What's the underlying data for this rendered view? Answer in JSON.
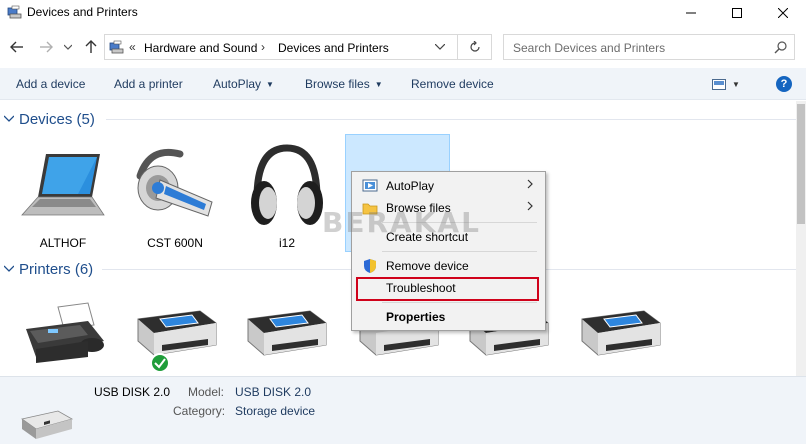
{
  "window": {
    "title": "Devices and Printers"
  },
  "address": {
    "overflow": "«",
    "crumbs": [
      "Hardware and Sound",
      "Devices and Printers"
    ],
    "separator": "›"
  },
  "search": {
    "placeholder": "Search Devices and Printers"
  },
  "commands": {
    "add_device": "Add a device",
    "add_printer": "Add a printer",
    "autoplay": "AutoPlay",
    "browse_files": "Browse files",
    "remove_device": "Remove device"
  },
  "groups": {
    "devices": {
      "title": "Devices (5)",
      "items": [
        "ALTHOF",
        "CST 600N",
        "i12"
      ]
    },
    "printers": {
      "title": "Printers (6)"
    }
  },
  "context_menu": {
    "items": [
      "AutoPlay",
      "Browse files",
      "Create shortcut",
      "Remove device",
      "Troubleshoot",
      "Properties"
    ]
  },
  "watermark": "BERAKAL",
  "details": {
    "name": "USB DISK 2.0",
    "model_label": "Model:",
    "model_value": "USB DISK 2.0",
    "category_label": "Category:",
    "category_value": "Storage device"
  },
  "colors": {
    "accent": "#1f4e8c",
    "highlight": "#d0021b",
    "selection": "#cce8ff"
  }
}
